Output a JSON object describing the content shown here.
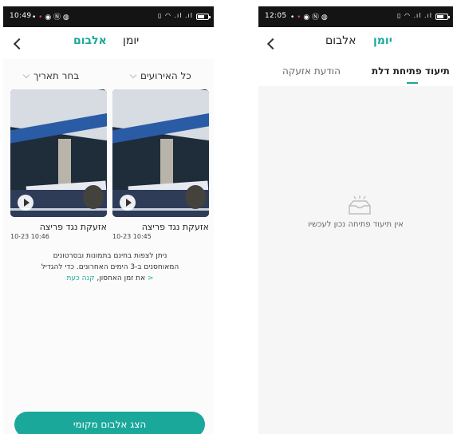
{
  "left": {
    "status": {
      "time": "10:49",
      "battery_level": 0.7
    },
    "nav": {
      "title_active": "אלבום",
      "title_other": "יומן"
    },
    "filters": {
      "date": "בחר תאריך",
      "events": "כל האירועים"
    },
    "cards": [
      {
        "title": "אזעקת נגד פריצה",
        "date": "10-23 10:45"
      },
      {
        "title": "אזעקת נגד פריצה",
        "date": "10-23 10:46"
      }
    ],
    "info": {
      "line1": "ניתן לצפות בחינם בתמונות ובסרטונים",
      "line2": "המאוחסנים ב-3 הימים האחרונים. כדי להגדיל",
      "line3": "את זמן האחסון, ",
      "link": "קנה כעת >"
    },
    "button": "הצג אלבום מקומי"
  },
  "right": {
    "status": {
      "time": "12:05",
      "battery_level": 0.7
    },
    "nav": {
      "title_active": "יומן",
      "title_other": "אלבום"
    },
    "tabs": {
      "active": "תיעוד פתיחת דלת",
      "inactive": "הודעת אזעקה"
    },
    "empty_text": "אין תיעוד פתיחה נכון לעכשיו"
  },
  "colors": {
    "accent": "#1aa89a",
    "statusbar": "#141414"
  }
}
